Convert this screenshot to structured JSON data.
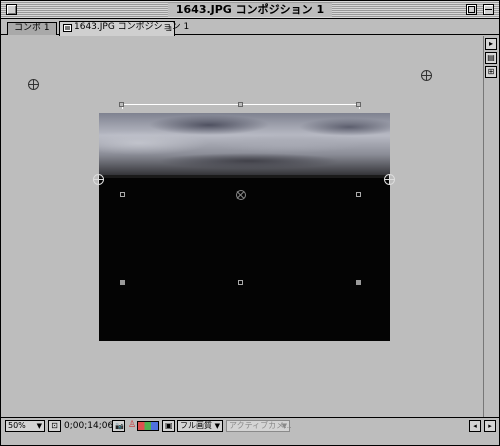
{
  "window": {
    "title": "1643.JPG コンポジション 1"
  },
  "tabs": [
    {
      "label": "コンポ 1"
    },
    {
      "label": "1643.JPG コンポジション 1",
      "close": "⊐"
    }
  ],
  "right_strip": {
    "arrow": "▸",
    "btn2": "▤",
    "btn3": "⊞"
  },
  "bottom_bar": {
    "zoom": "50%",
    "zoom_arrow": "▼",
    "fit_icon": "⊡",
    "timecode": "0;00;14;06",
    "snapshot_icon": "📷",
    "channel_icon": "♙",
    "region_icon": "▣",
    "resolution": "フル画質",
    "resolution_arrow": "▼",
    "camera": "アクティブカメ...",
    "camera_arrow": "▼",
    "scroll_left": "◂",
    "scroll_right": "▸"
  },
  "colors": {
    "window_bg": "#bdbdbd",
    "comp_bg": "#040404",
    "bracket": "#ffffff"
  }
}
